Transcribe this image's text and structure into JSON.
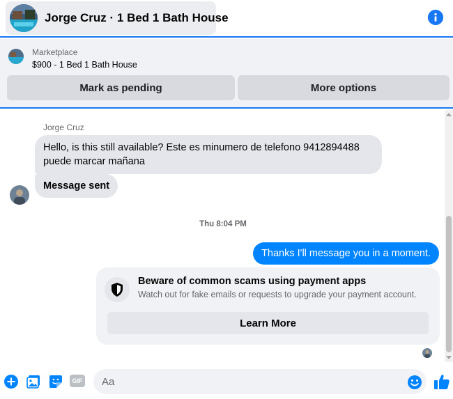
{
  "header": {
    "title": "Jorge Cruz · 1 Bed 1 Bath House",
    "avatar_icon": "house-pool-photo",
    "info_icon": "info-icon"
  },
  "marketplace": {
    "label": "Marketplace",
    "item": "$900 - 1 Bed 1 Bath House",
    "primary_button": "Mark as pending",
    "secondary_button": "More options"
  },
  "chat": {
    "sender_name": "Jorge Cruz",
    "incoming": [
      "Hello, is this still available? Este es minumero de telefono 9412894488 puede marcar mañana",
      "Message sent"
    ],
    "timestamp": "Thu 8:04 PM",
    "outgoing": "Thanks I'll message you in a moment.",
    "scam_warning": {
      "title": "Beware of common scams using payment apps",
      "description": "Watch out for fake emails or requests to upgrade your payment account.",
      "button": "Learn More",
      "icon": "shield-icon"
    }
  },
  "composer": {
    "placeholder": "Aa",
    "icons": [
      "plus-icon",
      "photo-icon",
      "sticker-icon",
      "gif-icon",
      "emoji-icon",
      "like-icon"
    ],
    "gif_label": "GIF"
  },
  "colors": {
    "accent": "#1877f2",
    "outgoing_bubble": "#0084ff",
    "incoming_bubble": "#e4e6eb"
  }
}
